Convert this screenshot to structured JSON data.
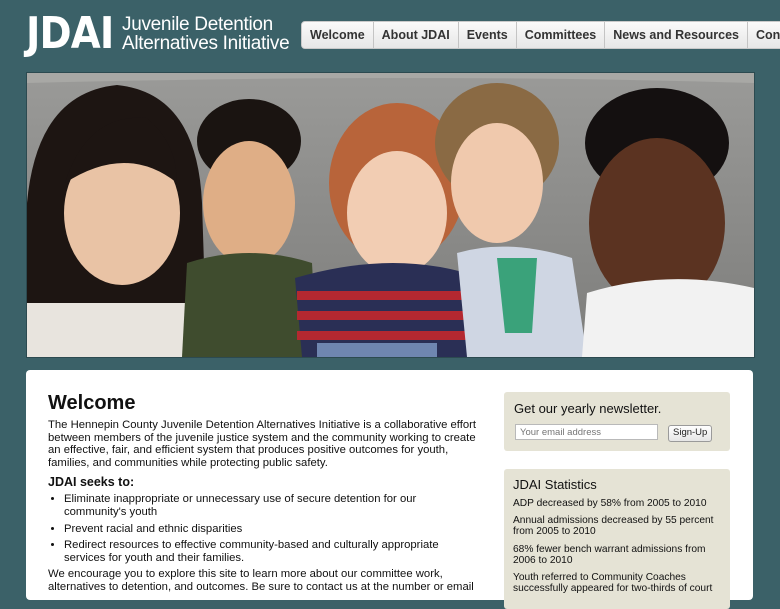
{
  "logo": {
    "mark": "JDAI",
    "line1": "Juvenile Detention",
    "line2": "Alternatives Initiative"
  },
  "nav": [
    "Welcome",
    "About JDAI",
    "Events",
    "Committees",
    "News and Resources",
    "Contact"
  ],
  "colors": {
    "page_bg": "#3b6168",
    "panel_bg": "#e5e3d5"
  },
  "main": {
    "title": "Welcome",
    "intro": "The Hennepin County Juvenile Detention Alternatives Initiative is a collaborative effort between members of the juvenile justice system and the community working to create an effective, fair, and efficient system that produces positive outcomes for youth, families, and communities while protecting public safety.",
    "seeks_heading": "JDAI seeks to:",
    "goals": [
      "Eliminate inappropriate or unnecessary use of secure detention for our community's youth",
      "Prevent racial and ethnic disparities",
      "Redirect resources to effective community-based and culturally appropriate services for youth and their families."
    ],
    "outro": "We encourage you to explore this site to learn more about our committee work, alternatives to detention, and outcomes. Be sure to contact us at the number or email"
  },
  "newsletter": {
    "title": "Get our yearly newsletter.",
    "placeholder": "Your email address",
    "button": "Sign-Up"
  },
  "stats": {
    "title": "JDAI Statistics",
    "items": [
      "ADP decreased by 58% from 2005 to 2010",
      "Annual admissions decreased by 55 percent from 2005 to 2010",
      "68% fewer bench warrant admissions from 2006 to 2010",
      "Youth referred to Community Coaches successfully appeared for two-thirds of court"
    ]
  }
}
